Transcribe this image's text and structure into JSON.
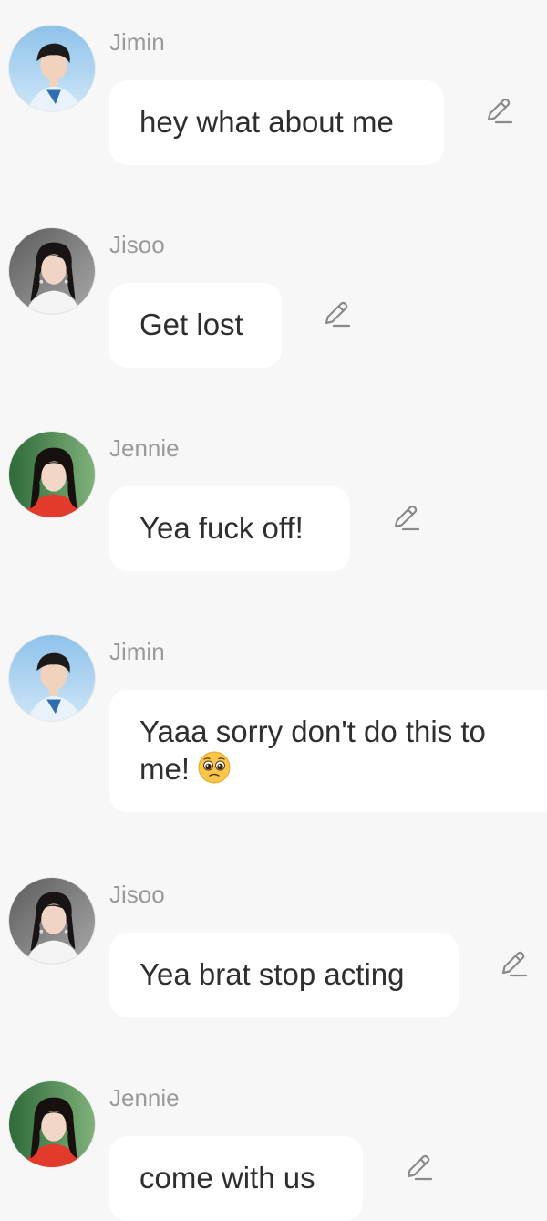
{
  "messages": [
    {
      "sender": "Jimin",
      "avatar_icon": "avatar-jimin-icon",
      "text": "hey what about me"
    },
    {
      "sender": "Jisoo",
      "avatar_icon": "avatar-jisoo-icon",
      "text": "Get lost"
    },
    {
      "sender": "Jennie",
      "avatar_icon": "avatar-jennie-icon",
      "text": "Yea fuck off!"
    },
    {
      "sender": "Jimin",
      "avatar_icon": "avatar-jimin-icon",
      "text": "Yaaa sorry don't do this to me!",
      "emoji": "pleading-face-emoji"
    },
    {
      "sender": "Jisoo",
      "avatar_icon": "avatar-jisoo-icon",
      "text": "Yea brat stop acting"
    },
    {
      "sender": "Jennie",
      "avatar_icon": "avatar-jennie-icon",
      "text": "come with us"
    }
  ],
  "icons": {
    "edit": "pencil-edit-icon"
  },
  "colors": {
    "background": "#f7f7f7",
    "bubble": "#ffffff",
    "sender_text": "#9a9a9a",
    "message_text": "#2e2e2e",
    "icon": "#8a8a8a"
  }
}
